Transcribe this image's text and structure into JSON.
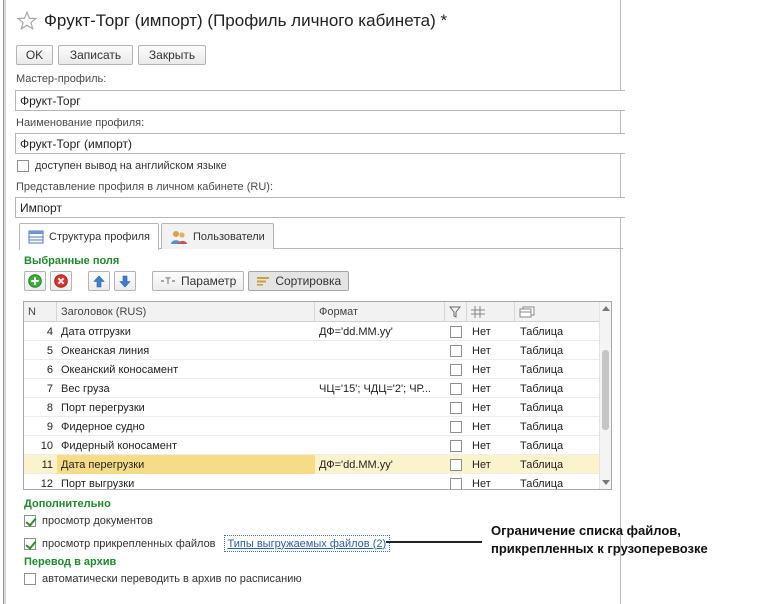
{
  "window": {
    "title": "Фрукт-Торг (импорт) (Профиль личного кабинета) *"
  },
  "toolbar": {
    "ok_label": "OK",
    "save_label": "Записать",
    "close_label": "Закрыть"
  },
  "fields": {
    "master_profile_label": "Мастер-профиль:",
    "master_profile_value": "Фрукт-Торг",
    "profile_name_label": "Наименование профиля:",
    "profile_name_value": "Фрукт-Торг (импорт)",
    "english_output_label": "доступен вывод на английском языке",
    "english_output_checked": false,
    "cabinet_view_label": "Представление профиля в личном кабинете (RU):",
    "cabinet_view_value": "Импорт"
  },
  "tabs": [
    {
      "label": "Структура профиля",
      "icon": "table-structure-icon",
      "active": true
    },
    {
      "label": "Пользователи",
      "icon": "users-icon",
      "active": false
    }
  ],
  "selected_fields": {
    "title": "Выбранные поля",
    "toolbar": {
      "add_icon": "add-icon",
      "delete_icon": "delete-icon",
      "move_up_icon": "arrow-up-icon",
      "move_down_icon": "arrow-down-icon",
      "param_label": "Параметр",
      "sort_label": "Сортировка"
    },
    "columns": [
      "N",
      "Заголовок (RUS)",
      "Формат",
      "filter-icon",
      "grid-icon",
      "table-icon"
    ],
    "rows": [
      {
        "n": "4",
        "title": "Дата отгрузки",
        "format": "ДФ='dd.MM.yy'",
        "checked": false,
        "flag": "Нет",
        "type": "Таблица",
        "selected": false
      },
      {
        "n": "5",
        "title": "Океанская линия",
        "format": "",
        "checked": false,
        "flag": "Нет",
        "type": "Таблица",
        "selected": false
      },
      {
        "n": "6",
        "title": "Океанский коносамент",
        "format": "",
        "checked": false,
        "flag": "Нет",
        "type": "Таблица",
        "selected": false
      },
      {
        "n": "7",
        "title": "Вес груза",
        "format": "ЧЦ='15'; ЧДЦ='2'; ЧР...",
        "checked": false,
        "flag": "Нет",
        "type": "Таблица",
        "selected": false
      },
      {
        "n": "8",
        "title": "Порт перегрузки",
        "format": "",
        "checked": false,
        "flag": "Нет",
        "type": "Таблица",
        "selected": false
      },
      {
        "n": "9",
        "title": "Фидерное судно",
        "format": "",
        "checked": false,
        "flag": "Нет",
        "type": "Таблица",
        "selected": false
      },
      {
        "n": "10",
        "title": "Фидерный коносамент",
        "format": "",
        "checked": false,
        "flag": "Нет",
        "type": "Таблица",
        "selected": false
      },
      {
        "n": "11",
        "title": "Дата перегрузки",
        "format": "ДФ='dd.MM.yy'",
        "checked": false,
        "flag": "Нет",
        "type": "Таблица",
        "selected": true
      },
      {
        "n": "12",
        "title": "Порт выгрузки",
        "format": "",
        "checked": false,
        "flag": "Нет",
        "type": "Таблица",
        "selected": false
      }
    ]
  },
  "additional": {
    "title": "Дополнительно",
    "view_docs_label": "просмотр документов",
    "view_docs_checked": true,
    "view_attached_label": "просмотр прикрепленных файлов",
    "view_attached_checked": true,
    "file_types_link": "Типы выгружаемых файлов (2)"
  },
  "archive": {
    "title": "Перевод в архив",
    "auto_archive_label": "автоматически переводить в архив по расписанию",
    "auto_archive_checked": false
  },
  "annotation": {
    "line1": "Ограничение списка файлов,",
    "line2": "прикрепленных к грузоперевозке"
  },
  "colors": {
    "section_green": "#1f8a2a",
    "selected_row": "#fbf3cd",
    "selected_cell": "#f6dc86",
    "link_blue": "#2b5ea7"
  }
}
